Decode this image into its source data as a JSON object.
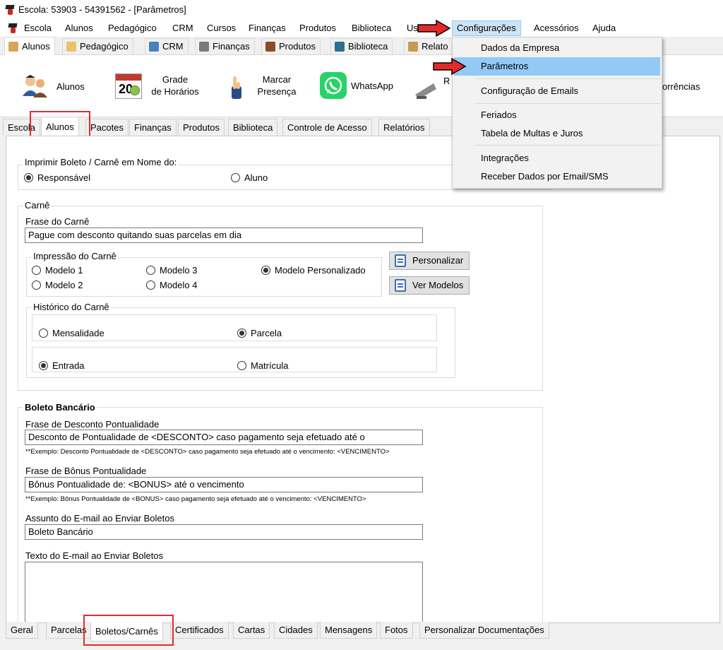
{
  "window": {
    "title": "Escola: 53903 - 54391562 - [Parâmetros]"
  },
  "menubar": {
    "items": [
      "Escola",
      "Alunos",
      "Pedagógico",
      "CRM",
      "Cursos",
      "Finanças",
      "Produtos",
      "Biblioteca",
      "Us",
      "Configurações",
      "Acessórios",
      "Ajuda"
    ],
    "active": "Configurações"
  },
  "toolbar_tabs": [
    "Alunos",
    "Pedagógico",
    "CRM",
    "Finanças",
    "Produtos",
    "Biblioteca",
    "Relato"
  ],
  "ribbon": {
    "alunos": "Alunos",
    "grade_line1": "Grade",
    "grade_line2": "de Horários",
    "marcar_line1": "Marcar",
    "marcar_line2": "Presença",
    "whatsapp": "WhatsApp",
    "calendar_day": "20",
    "partial_r": "R",
    "ocorrencias": "orrências"
  },
  "page_tabs": [
    "Escola",
    "Alunos",
    "Pacotes",
    "Finanças",
    "Produtos",
    "Biblioteca",
    "Controle de Acesso",
    "Relatórios"
  ],
  "imprimir": {
    "title": "Imprimir Boleto / Carnê em Nome do:",
    "opt_responsavel": "Responsável",
    "opt_aluno": "Aluno"
  },
  "carne": {
    "title": "Carnê",
    "frase_label": "Frase do Carnê",
    "frase_value": "Pague com desconto quitando suas parcelas em dia",
    "impressao_title": "Impressão do Carnê",
    "modelo1": "Modelo 1",
    "modelo2": "Modelo 2",
    "modelo3": "Modelo 3",
    "modelo4": "Modelo 4",
    "modelo_personalizado": "Modelo Personalizado",
    "btn_personalizar": "Personalizar",
    "btn_ver_modelos": "Ver Modelos",
    "historico_title": "Histórico do Carnê",
    "mensalidade": "Mensalidade",
    "parcela": "Parcela",
    "entrada": "Entrada",
    "matricula": "Matrícula"
  },
  "boleto": {
    "title": "Boleto Bancário",
    "desconto_label": "Frase de Desconto Pontualidade",
    "desconto_value": "Desconto de Pontualidade de <DESCONTO> caso pagamento seja efetuado até o",
    "desconto_example": "**Exemplo: Desconto Pontualidade de <DESCONTO> caso pagamento seja efetuado até o vencimento: <VENCIMENTO>",
    "bonus_label": "Frase de Bônus Pontualidade",
    "bonus_value": "Bônus Pontualidade de: <BONUS> até o vencimento",
    "bonus_example": "**Exemplo: Bônus Pontualidade de <BONUS> caso pagamento seja efetuado até o vencimento: <VENCIMENTO>",
    "assunto_label": "Assunto do E-mail ao Enviar Boletos",
    "assunto_value": "Boleto Bancário",
    "texto_label": "Texto do E-mail ao Enviar Boletos",
    "texto_value": ""
  },
  "bottom_tabs": [
    "Geral",
    "Parcelas",
    "Boletos/Carnês",
    "Certificados",
    "Cartas",
    "Cidades",
    "Mensagens",
    "Fotos",
    "Personalizar Documentações"
  ],
  "dropdown": {
    "items": [
      "Dados da Empresa",
      "Parâmetros",
      "Configuração de Emails",
      "Feriados",
      "Tabela de Multas e Juros",
      "Integrações",
      "Receber Dados por Email/SMS"
    ],
    "highlighted": "Parâmetros"
  },
  "colors": {
    "highlight": "#91c9f7",
    "menu_active": "#cce4f7",
    "annotation_red": "#e32a2a",
    "whatsapp_green": "#25d366"
  }
}
